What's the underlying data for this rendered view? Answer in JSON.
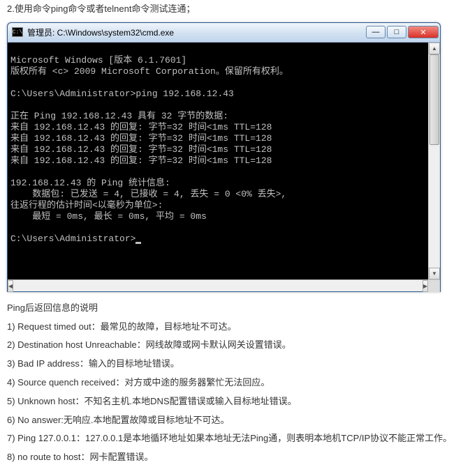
{
  "doc": {
    "step2": "2.使用命令ping命令或者telnent命令测试连通；",
    "ping_info_title": "Ping后返回信息的说明",
    "notes": [
      "1) Request timed out：最常见的故障，目标地址不可达。",
      "2) Destination host Unreachable：网线故障或网卡默认网关设置错误。",
      "3) Bad IP address：输入的目标地址错误。",
      "4) Source quench received：对方或中途的服务器繁忙无法回应。",
      "5) Unknown host：不知名主机.本地DNS配置错误或输入目标地址错误。",
      "6) No answer:无响应.本地配置故障或目标地址不可达。",
      "7) Ping 127.0.0.1：127.0.0.1是本地循环地址如果本地址无法Ping通，则表明本地机TCP/IP协议不能正常工作。",
      "8) no route to host：网卡配置错误。"
    ]
  },
  "cmd": {
    "title_prefix": "管理员: ",
    "title_path": "C:\\Windows\\system32\\cmd.exe",
    "lines": [
      "Microsoft Windows [版本 6.1.7601]",
      "版权所有 <c> 2009 Microsoft Corporation。保留所有权利。",
      "",
      "C:\\Users\\Administrator>ping 192.168.12.43",
      "",
      "正在 Ping 192.168.12.43 具有 32 字节的数据:",
      "来自 192.168.12.43 的回复: 字节=32 时间<1ms TTL=128",
      "来自 192.168.12.43 的回复: 字节=32 时间<1ms TTL=128",
      "来自 192.168.12.43 的回复: 字节=32 时间<1ms TTL=128",
      "来自 192.168.12.43 的回复: 字节=32 时间<1ms TTL=128",
      "",
      "192.168.12.43 的 Ping 统计信息:",
      "    数据包: 已发送 = 4, 已接收 = 4, 丢失 = 0 <0% 丢失>,",
      "往返行程的估计时间<以毫秒为单位>:",
      "    最短 = 0ms, 最长 = 0ms, 平均 = 0ms",
      "",
      "C:\\Users\\Administrator>"
    ],
    "icon_glyph": "C:\\"
  },
  "winbtn": {
    "min": "—",
    "max": "□",
    "close": "✕"
  },
  "sb": {
    "up": "▲",
    "down": "▼",
    "left": "◀",
    "right": "▶"
  }
}
